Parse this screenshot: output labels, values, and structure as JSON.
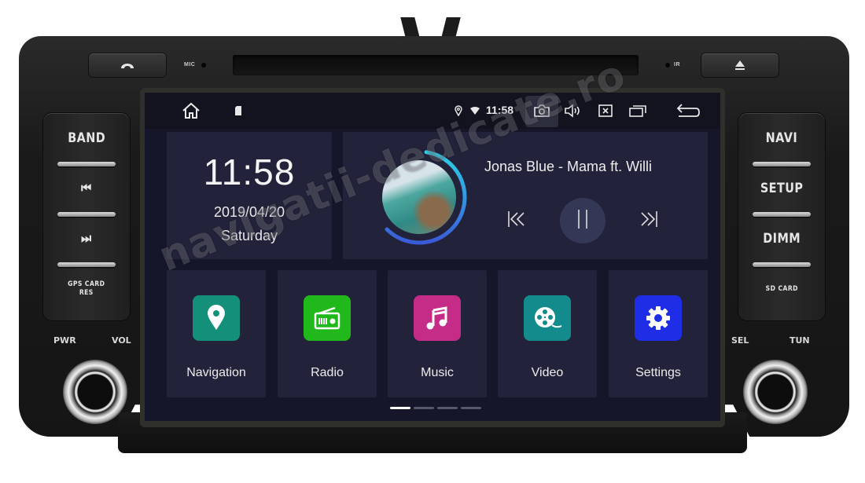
{
  "device": {
    "top_buttons": {
      "call_icon": "phone-hangup-icon",
      "eject_icon": "eject-icon",
      "mic_label": "MIC",
      "ir_label": "IR"
    },
    "left_panel": {
      "buttons": [
        {
          "label": "BAND",
          "type": "text"
        },
        {
          "label": "⏮",
          "type": "icon",
          "icon": "previous-track-icon"
        },
        {
          "label": "⏭",
          "type": "icon",
          "icon": "next-track-icon"
        },
        {
          "label": "GPS CARD\nRES",
          "type": "small"
        }
      ],
      "knob_labels": [
        "PWR",
        "VOL"
      ]
    },
    "right_panel": {
      "buttons": [
        {
          "label": "NAVI",
          "type": "text"
        },
        {
          "label": "SETUP",
          "type": "text"
        },
        {
          "label": "DIMM",
          "type": "text"
        },
        {
          "label": "SD CARD",
          "type": "small"
        }
      ],
      "knob_labels": [
        "SEL",
        "TUN"
      ]
    }
  },
  "statusbar": {
    "time": "11:58",
    "icons": [
      "home-icon",
      "sd-card-icon",
      "location-icon",
      "wifi-icon",
      "screenshot-camera-icon",
      "volume-icon",
      "close-app-icon",
      "recent-apps-icon",
      "back-icon"
    ]
  },
  "clock_widget": {
    "time": "11:58",
    "date": "2019/04/20",
    "day": "Saturday"
  },
  "music_widget": {
    "title": "Jonas Blue - Mama ft. Willi",
    "progress_fraction": 0.62,
    "controls": [
      "previous",
      "pause",
      "next"
    ]
  },
  "apps": [
    {
      "label": "Navigation",
      "icon": "map-pin-icon",
      "color": "#14907a"
    },
    {
      "label": "Radio",
      "icon": "radio-icon",
      "color": "#21b81c"
    },
    {
      "label": "Music",
      "icon": "music-note-icon",
      "color": "#c52c87"
    },
    {
      "label": "Video",
      "icon": "film-reel-icon",
      "color": "#138a8c"
    },
    {
      "label": "Settings",
      "icon": "gear-icon",
      "color": "#1f2ee6"
    }
  ],
  "pager": {
    "pages": 4,
    "active": 1
  },
  "watermark": "navigatii-dedicate.ro"
}
